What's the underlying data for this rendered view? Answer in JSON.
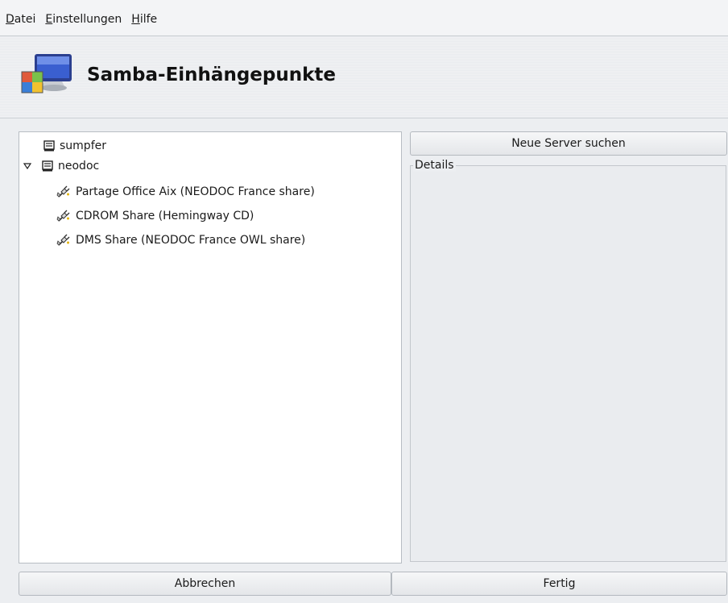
{
  "menubar": {
    "items": [
      {
        "mnemonic": "D",
        "rest": "atei"
      },
      {
        "mnemonic": "E",
        "rest": "instellungen"
      },
      {
        "mnemonic": "H",
        "rest": "ilfe"
      }
    ]
  },
  "header": {
    "title": "Samba-Einhängepunkte",
    "icon": "network-computer-icon"
  },
  "tree": {
    "servers": [
      {
        "label": "sumpfer",
        "expanded": false,
        "icon": "server-icon"
      },
      {
        "label": "neodoc",
        "expanded": true,
        "icon": "server-icon",
        "shares": [
          {
            "label": "Partage Office Aix (NEODOC France share)",
            "icon": "share-plug-icon"
          },
          {
            "label": "CDROM Share (Hemingway CD)",
            "icon": "share-plug-icon"
          },
          {
            "label": "DMS Share (NEODOC France OWL share)",
            "icon": "share-plug-icon"
          }
        ]
      }
    ]
  },
  "right": {
    "search_button": "Neue Server suchen",
    "details_label": "Details"
  },
  "footer": {
    "cancel_button": "Abbrechen",
    "finish_button": "Fertig"
  }
}
